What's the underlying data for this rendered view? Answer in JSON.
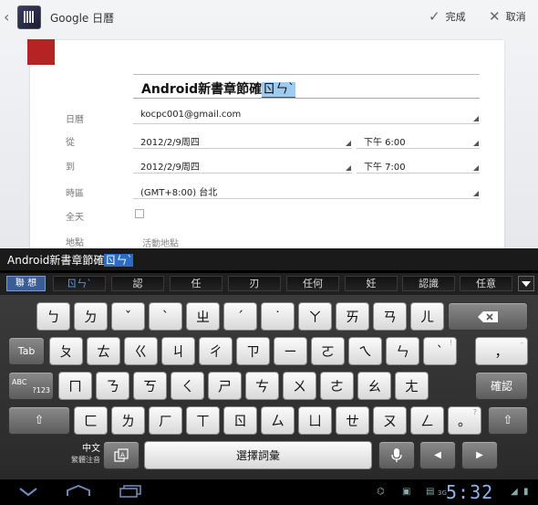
{
  "app": {
    "title": "Google 日曆",
    "done_label": "完成",
    "cancel_label": "取消"
  },
  "event": {
    "title_text": "Android新書章節確",
    "title_composing": "ㄖㄣˋ",
    "calendar_label": "日曆",
    "calendar_value": "kocpc001@gmail.com",
    "from_label": "從",
    "from_date": "2012/2/9周四",
    "from_time": "下午 6:00",
    "to_label": "到",
    "to_date": "2012/2/9周四",
    "to_time": "下午 7:00",
    "timezone_label": "時區",
    "timezone_value": "(GMT+8:00) 台北",
    "allday_label": "全天",
    "location_label": "地點",
    "location_placeholder": "活動地點"
  },
  "ime": {
    "composing_text": "Android新書章節確",
    "composing_highlight": "ㄖㄣˋ",
    "switch_label": "聯 想",
    "candidates": [
      "ㄖㄣˋ",
      "認",
      "任",
      "刃",
      "任何",
      "妊",
      "認識",
      "任意"
    ],
    "keys_row1": [
      "ㄅ",
      "ㄉ",
      "ˇ",
      "ˋ",
      "ㄓ",
      "ˊ",
      "˙",
      "ㄚ",
      "ㄞ",
      "ㄢ",
      "ㄦ"
    ],
    "keys_row2": [
      "ㄆ",
      "ㄊ",
      "ㄍ",
      "ㄐ",
      "ㄔ",
      "ㄗ",
      "ㄧ",
      "ㄛ",
      "ㄟ",
      "ㄣ",
      "ˋ",
      "，"
    ],
    "keys_row3": [
      "ㄇ",
      "ㄋ",
      "ㄎ",
      "ㄑ",
      "ㄕ",
      "ㄘ",
      "ㄨ",
      "ㄜ",
      "ㄠ",
      "ㄤ"
    ],
    "keys_row4": [
      "ㄈ",
      "ㄌ",
      "ㄏ",
      "ㄒ",
      "ㄖ",
      "ㄙ",
      "ㄩ",
      "ㄝ",
      "ㄡ",
      "ㄥ",
      "。"
    ],
    "hints": {
      "row2_last2": "!",
      "row2_last": "-",
      "row4_last": "?"
    },
    "tab_label": "Tab",
    "abc_label": "ABC",
    "num_label": "?123",
    "confirm_label": "確認",
    "lang_label": "中文",
    "lang_sub_label": "繁體注音",
    "space_label": "選擇詞彙",
    "clock": "5:32",
    "signal": "3G"
  }
}
